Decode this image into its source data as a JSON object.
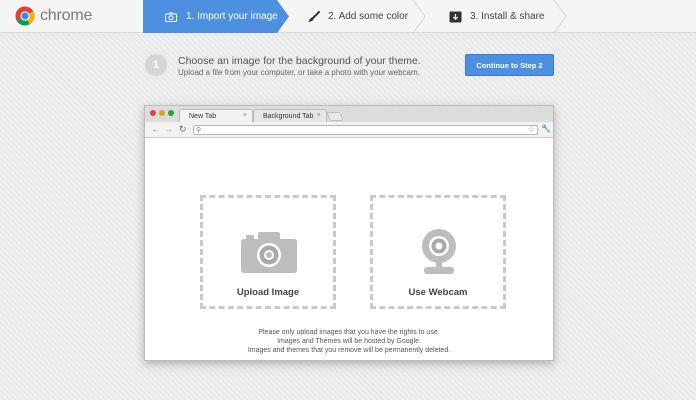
{
  "brand": {
    "name": "chrome"
  },
  "steps": [
    {
      "label": "1. Import your image",
      "icon": "camera-icon"
    },
    {
      "label": "2. Add some color",
      "icon": "paintbrush-icon"
    },
    {
      "label": "3. Install & share",
      "icon": "install-icon"
    }
  ],
  "instruction": {
    "number": "1",
    "title": "Choose an image for the background of your theme.",
    "subtitle": "Upload a file from your computer, or take a photo with your webcam.",
    "continue_label": "Continue to Step 2"
  },
  "browser": {
    "tabs": [
      "New Tab",
      "Background Tab"
    ],
    "tab_close": "×"
  },
  "dropzones": {
    "upload_label": "Upload Image",
    "webcam_label": "Use Webcam"
  },
  "notices": [
    "Please only upload images that you have the rights to use.",
    "Images and Themes will be hosted by Google.",
    "Images and themes that you remove will be permanently deleted."
  ],
  "colors": {
    "accent": "#4d90e0",
    "background": "#ececec"
  }
}
